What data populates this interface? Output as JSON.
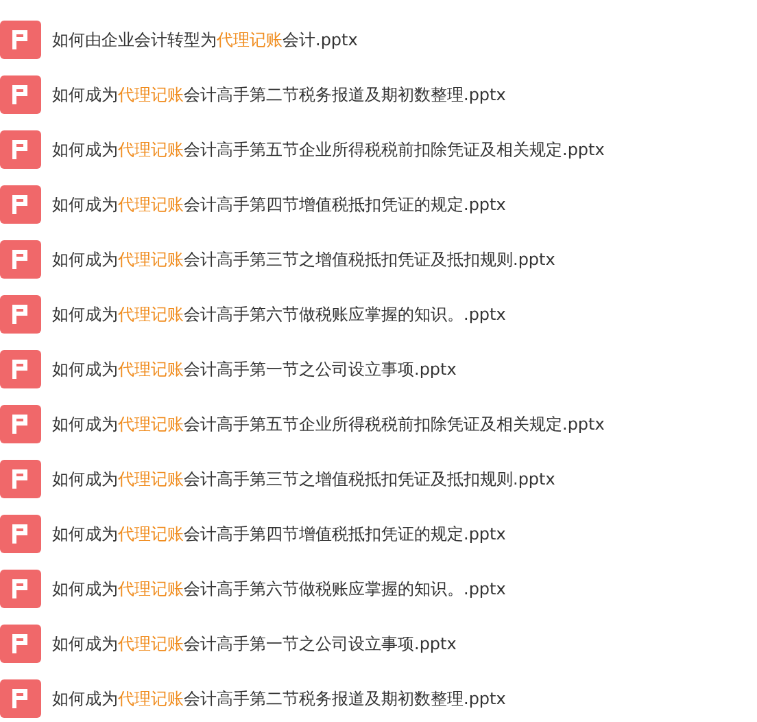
{
  "files": [
    {
      "before": "如何由企业会计转型为",
      "highlight": "代理记账",
      "after": "会计.pptx"
    },
    {
      "before": "如何成为",
      "highlight": "代理记账",
      "after": "会计高手第二节税务报道及期初数整理.pptx"
    },
    {
      "before": "如何成为",
      "highlight": "代理记账",
      "after": "会计高手第五节企业所得税税前扣除凭证及相关规定.pptx"
    },
    {
      "before": "如何成为",
      "highlight": "代理记账",
      "after": "会计高手第四节增值税抵扣凭证的规定.pptx"
    },
    {
      "before": "如何成为",
      "highlight": "代理记账",
      "after": "会计高手第三节之增值税抵扣凭证及抵扣规则.pptx"
    },
    {
      "before": "如何成为",
      "highlight": "代理记账",
      "after": "会计高手第六节做税账应掌握的知识。.pptx"
    },
    {
      "before": "如何成为",
      "highlight": "代理记账",
      "after": "会计高手第一节之公司设立事项.pptx"
    },
    {
      "before": "如何成为",
      "highlight": "代理记账",
      "after": "会计高手第五节企业所得税税前扣除凭证及相关规定.pptx"
    },
    {
      "before": "如何成为",
      "highlight": "代理记账",
      "after": "会计高手第三节之增值税抵扣凭证及抵扣规则.pptx"
    },
    {
      "before": "如何成为",
      "highlight": "代理记账",
      "after": "会计高手第四节增值税抵扣凭证的规定.pptx"
    },
    {
      "before": "如何成为",
      "highlight": "代理记账",
      "after": "会计高手第六节做税账应掌握的知识。.pptx"
    },
    {
      "before": "如何成为",
      "highlight": "代理记账",
      "after": "会计高手第一节之公司设立事项.pptx"
    },
    {
      "before": "如何成为",
      "highlight": "代理记账",
      "after": "会计高手第二节税务报道及期初数整理.pptx"
    }
  ]
}
